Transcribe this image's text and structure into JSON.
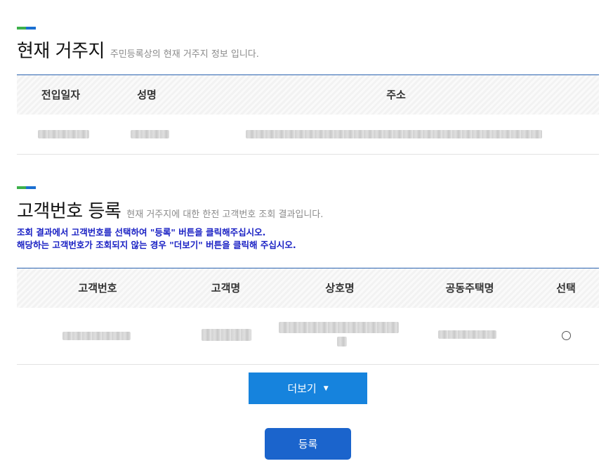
{
  "residence": {
    "title": "현재 거주지",
    "subtitle": "주민등록상의 현재 거주지 정보 입니다.",
    "columns": [
      "전입일자",
      "성명",
      "주소"
    ]
  },
  "customer": {
    "title": "고객번호 등록",
    "subtitle": "현재 거주지에 대한 한전 고객번호 조회 결과입니다.",
    "notice_line1": "조회 결과에서 고객번호를 선택하여 \"등록\" 버튼을 클릭해주십시오.",
    "notice_line2": "해당하는 고객번호가 조회되지 않는 경우 \"더보기\" 버튼을 클릭해 주십시오.",
    "columns": [
      "고객번호",
      "고객명",
      "상호명",
      "공동주택명",
      "선택"
    ]
  },
  "buttons": {
    "more_label": "더보기",
    "more_caret": "▼",
    "register_label": "등록"
  },
  "colors": {
    "mark_green": "#3db04a",
    "mark_blue": "#1a6fd1",
    "notice": "#1a21c4",
    "more_button": "#1683dd",
    "register_button": "#1b64cc"
  }
}
